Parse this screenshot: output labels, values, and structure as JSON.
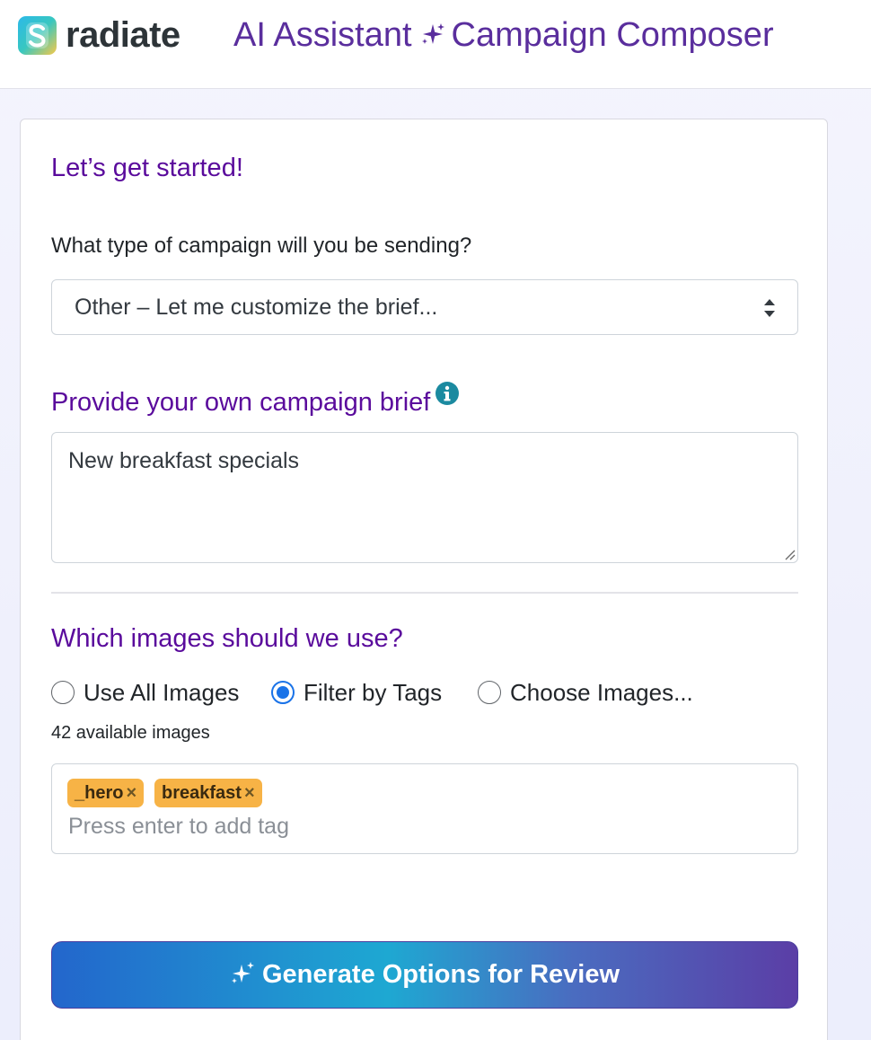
{
  "header": {
    "brand": "radiate",
    "title_part1": "AI Assistant",
    "title_part2": "Campaign Composer"
  },
  "card": {
    "heading": "Let’s get started!",
    "campaign_type_label": "What type of campaign will you be sending?",
    "campaign_type_selected": "Other – Let me customize the brief...",
    "brief_heading": "Provide your own campaign brief",
    "brief_value": "New breakfast specials",
    "images_heading": "Which images should we use?",
    "image_options": [
      {
        "label": "Use All Images",
        "checked": false
      },
      {
        "label": "Filter by Tags",
        "checked": true
      },
      {
        "label": "Choose Images...",
        "checked": false
      }
    ],
    "available_images": "42 available images",
    "tags": [
      {
        "label": "_hero",
        "remove": "×"
      },
      {
        "label": "breakfast",
        "remove": "×"
      }
    ],
    "tag_placeholder": "Press enter to add tag",
    "generate_button": "Generate Options for Review"
  },
  "colors": {
    "title_purple": "#5a2e9d",
    "heading_purple": "#5a0b9c",
    "tag_orange": "#f7b346",
    "radio_blue": "#1a73e8",
    "info_teal": "#1b8aa0"
  },
  "icons": [
    "s-logo-icon",
    "sparkle-icon",
    "select-arrows-icon",
    "info-icon",
    "resize-handle-icon",
    "tag-remove-icon"
  ]
}
